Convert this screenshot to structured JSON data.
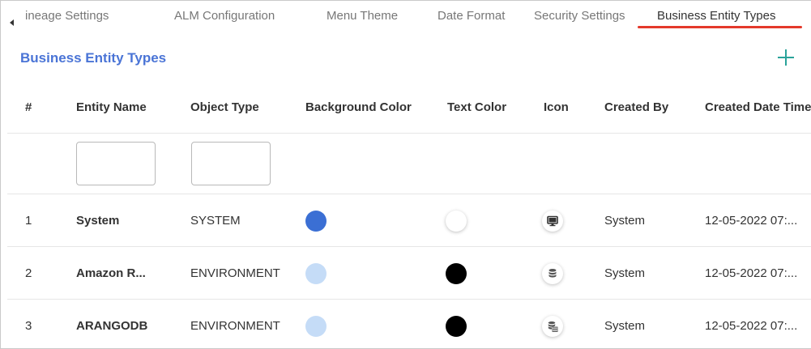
{
  "tabs": [
    {
      "label": "ineage Settings",
      "active": false
    },
    {
      "label": "ALM Configuration",
      "active": false
    },
    {
      "label": "Menu Theme",
      "active": false
    },
    {
      "label": "Date Format",
      "active": false
    },
    {
      "label": "Security Settings",
      "active": false
    },
    {
      "label": "Business Entity Types",
      "active": true
    }
  ],
  "section": {
    "title": "Business Entity Types"
  },
  "columns": [
    "#",
    "Entity Name",
    "Object Type",
    "Background Color",
    "Text Color",
    "Icon",
    "Created By",
    "Created Date Time"
  ],
  "filters": {
    "entity_name": "",
    "object_type": ""
  },
  "rows": [
    {
      "num": "1",
      "entity_name": "System",
      "object_type": "SYSTEM",
      "background_color": "#3b6fd4",
      "text_color": "#ffffff",
      "icon": "monitor-icon",
      "created_by": "System",
      "created_date": "12-05-2022 07:..."
    },
    {
      "num": "2",
      "entity_name": "Amazon R...",
      "object_type": "ENVIRONMENT",
      "background_color": "#c5dcf7",
      "text_color": "#000000",
      "icon": "database-icon",
      "created_by": "System",
      "created_date": "12-05-2022 07:..."
    },
    {
      "num": "3",
      "entity_name": "ARANGODB",
      "object_type": "ENVIRONMENT",
      "background_color": "#c5dcf7",
      "text_color": "#000000",
      "icon": "database-grid-icon",
      "created_by": "System",
      "created_date": "12-05-2022 07:..."
    }
  ],
  "colors": {
    "accent_title": "#4a74d6",
    "active_tab_underline": "#e4392b",
    "add_button": "#2aa39a"
  }
}
